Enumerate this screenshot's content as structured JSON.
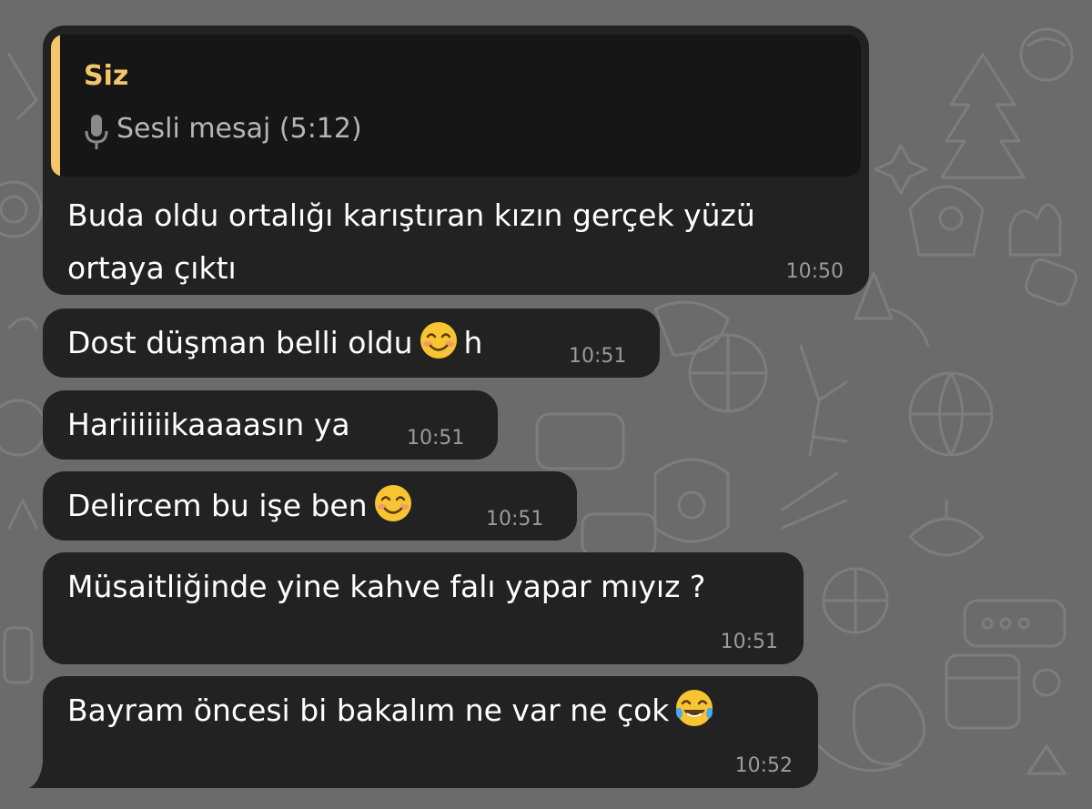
{
  "reply": {
    "sender": "Siz",
    "preview": "Sesli mesaj (5:12)",
    "icon": "microphone-icon"
  },
  "messages": [
    {
      "text_line1": "Buda oldu ortalığı karıştıran kızın gerçek yüzü",
      "text_line2": "ortaya çıktı",
      "time": "10:50"
    },
    {
      "text_before": "Dost düşman belli oldu",
      "emoji": "smiling-face-emoji",
      "text_after": "h",
      "time": "10:51"
    },
    {
      "text": "Hariiiiiikaaaasın ya",
      "time": "10:51"
    },
    {
      "text_before": "Delircem bu işe ben",
      "emoji": "smiling-face-emoji",
      "time": "10:51"
    },
    {
      "text": "Müsaitliğinde yine kahve falı yapar mıyız ?",
      "time": "10:51"
    },
    {
      "text_before": "Bayram öncesi bi bakalım ne var ne çok",
      "emoji": "tears-of-joy-emoji",
      "time": "10:52"
    }
  ],
  "colors": {
    "background": "#6b6b6b",
    "bubble": "#222222",
    "reply_box": "#161616",
    "reply_accent": "#f4c66a",
    "timestamp": "#9b9b9b"
  }
}
